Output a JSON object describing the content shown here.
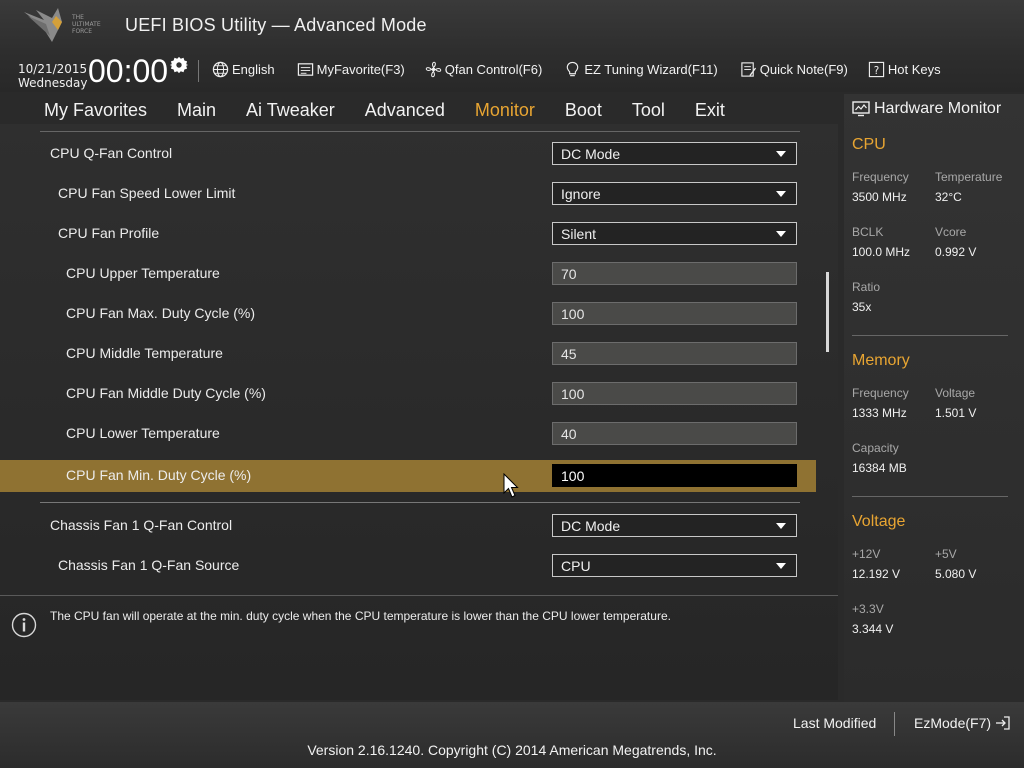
{
  "header": {
    "app_title": "UEFI BIOS Utility — Advanced Mode",
    "logo_text": "THE ULTIMATE FORCE",
    "date": "10/21/2015",
    "weekday": "Wednesday",
    "time": "00:00",
    "toolbar": [
      {
        "label": "English",
        "icon": "globe-icon"
      },
      {
        "label": "MyFavorite(F3)",
        "icon": "favorite-list-icon"
      },
      {
        "label": "Qfan Control(F6)",
        "icon": "fan-icon"
      },
      {
        "label": "EZ Tuning Wizard(F11)",
        "icon": "lightbulb-icon"
      },
      {
        "label": "Quick Note(F9)",
        "icon": "note-icon"
      },
      {
        "label": "Hot Keys",
        "icon": "help-box-icon"
      }
    ]
  },
  "tabs": [
    {
      "label": "My Favorites"
    },
    {
      "label": "Main"
    },
    {
      "label": "Ai Tweaker"
    },
    {
      "label": "Advanced"
    },
    {
      "label": "Monitor",
      "active": true
    },
    {
      "label": "Boot"
    },
    {
      "label": "Tool"
    },
    {
      "label": "Exit"
    }
  ],
  "settings": [
    {
      "label": "CPU Q-Fan Control",
      "value": "DC Mode",
      "type": "select"
    },
    {
      "label": "CPU Fan Speed Lower Limit",
      "value": "Ignore",
      "type": "select"
    },
    {
      "label": "CPU Fan Profile",
      "value": "Silent",
      "type": "select"
    },
    {
      "label": "CPU Upper Temperature",
      "value": "70",
      "type": "number"
    },
    {
      "label": "CPU Fan Max. Duty Cycle (%)",
      "value": "100",
      "type": "number"
    },
    {
      "label": "CPU Middle Temperature",
      "value": "45",
      "type": "number"
    },
    {
      "label": "CPU Fan Middle Duty Cycle (%)",
      "value": "100",
      "type": "number"
    },
    {
      "label": "CPU Lower Temperature",
      "value": "40",
      "type": "number"
    },
    {
      "label": "CPU Fan Min. Duty Cycle (%)",
      "value": "100",
      "type": "number",
      "selected": true
    },
    {
      "label": "Chassis Fan 1 Q-Fan Control",
      "value": "DC Mode",
      "type": "select"
    },
    {
      "label": "Chassis Fan 1 Q-Fan Source",
      "value": "CPU",
      "type": "select"
    }
  ],
  "help_text": "The CPU fan will operate at the min. duty cycle when the CPU temperature is lower than the CPU lower temperature.",
  "hardware_monitor": {
    "title": "Hardware Monitor",
    "cpu": {
      "heading": "CPU",
      "frequency_label": "Frequency",
      "frequency": "3500 MHz",
      "temperature_label": "Temperature",
      "temperature": "32°C",
      "bclk_label": "BCLK",
      "bclk": "100.0 MHz",
      "vcore_label": "Vcore",
      "vcore": "0.992 V",
      "ratio_label": "Ratio",
      "ratio": "35x"
    },
    "memory": {
      "heading": "Memory",
      "frequency_label": "Frequency",
      "frequency": "1333 MHz",
      "voltage_label": "Voltage",
      "voltage": "1.501 V",
      "capacity_label": "Capacity",
      "capacity": "16384 MB"
    },
    "voltage": {
      "heading": "Voltage",
      "v12_label": "+12V",
      "v12": "12.192 V",
      "v5_label": "+5V",
      "v5": "5.080 V",
      "v33_label": "+3.3V",
      "v33": "3.344 V"
    }
  },
  "footer": {
    "last_modified": "Last Modified",
    "ezmode": "EzMode(F7)",
    "version": "Version 2.16.1240. Copyright (C) 2014 American Megatrends, Inc."
  },
  "colors": {
    "accent": "#e8a532",
    "highlight_row": "#8f7232",
    "background": "#2a2a2a"
  }
}
